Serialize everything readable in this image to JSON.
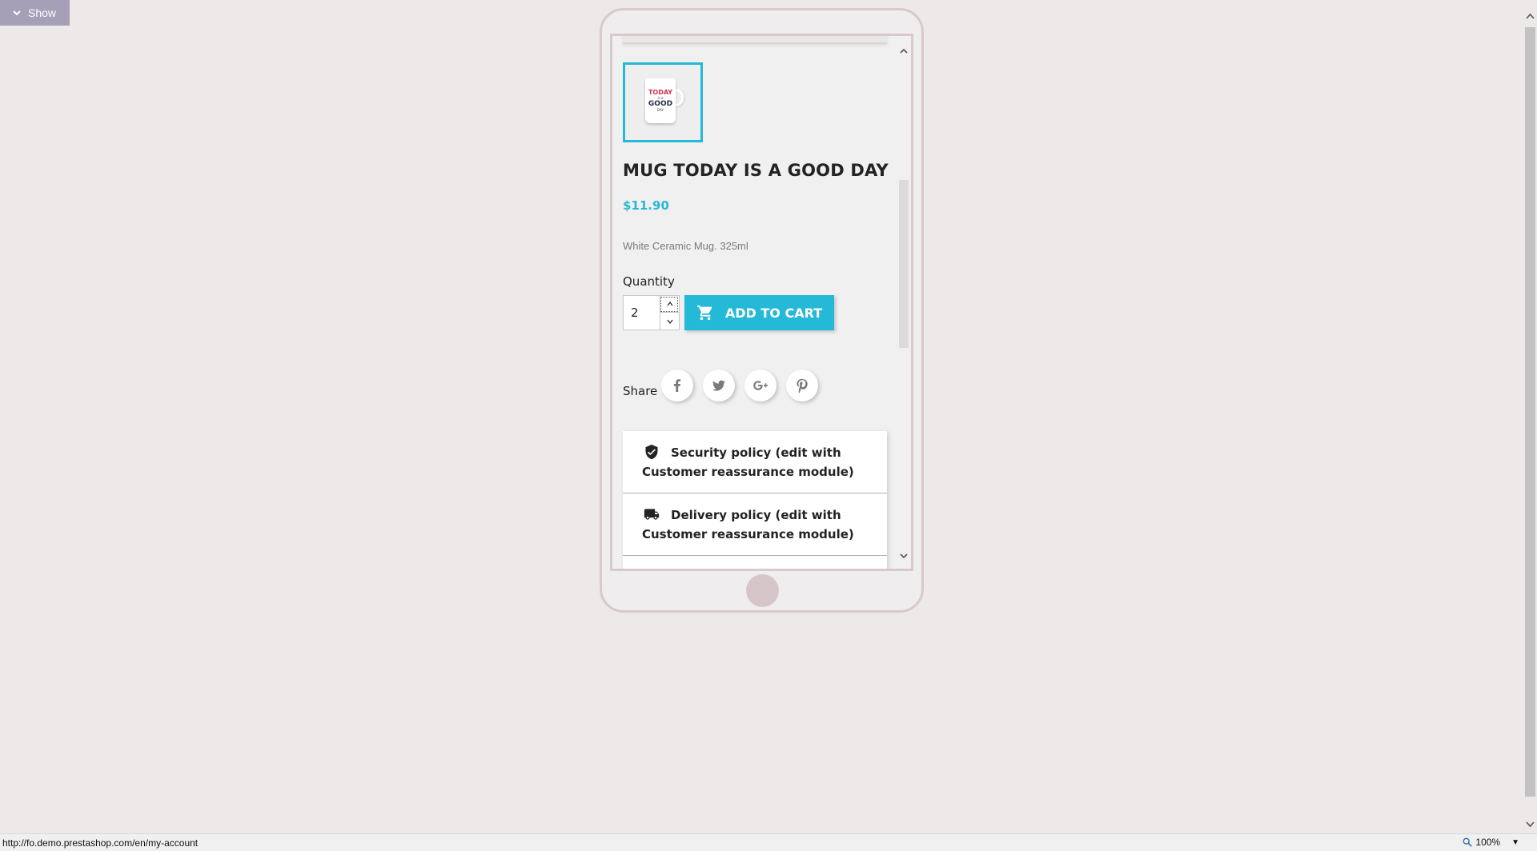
{
  "toolbar": {
    "show_label": "Show"
  },
  "product": {
    "thumbnail_alt": "TODAY IS A GOOD DAY",
    "mug_print": {
      "line1": "TODAY",
      "line2": "is a",
      "line3": "GOOD",
      "line4": "DAY"
    },
    "title": "MUG TODAY IS A GOOD DAY",
    "price": "$11.90",
    "short_description": "White Ceramic Mug. 325ml",
    "quantity_label": "Quantity",
    "quantity_value": "2",
    "add_to_cart_label": "ADD TO CART",
    "share_label": "Share",
    "share_buttons": [
      "facebook-icon",
      "twitter-icon",
      "google-plus-icon",
      "pinterest-icon"
    ],
    "reassurance": [
      {
        "icon": "shield-check-icon",
        "text": "Security policy (edit with Customer reassurance module)"
      },
      {
        "icon": "delivery-truck-icon",
        "text": "Delivery policy (edit with Customer reassurance module)"
      }
    ]
  },
  "status_bar": {
    "url": "http://fo.demo.prestashop.com/en/my-account",
    "zoom": "100%"
  },
  "colors": {
    "accent": "#24b9d7",
    "background": "#ece9e8",
    "phone_frame": "#d9c9cb",
    "toggle_bg": "#a59fb8"
  }
}
